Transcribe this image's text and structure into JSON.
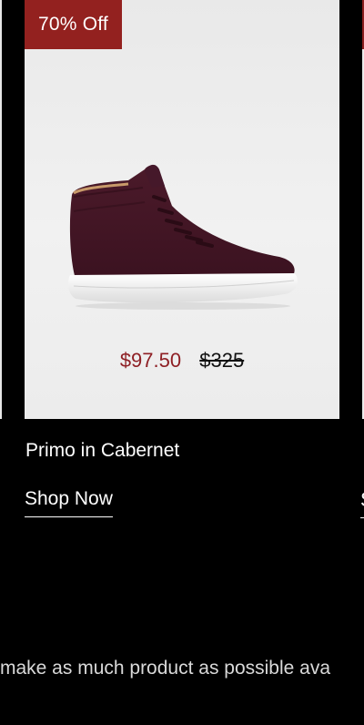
{
  "colors": {
    "background": "#000000",
    "badge": "#93211f",
    "sale_price": "#8e1f24",
    "text_light": "#ffffff"
  },
  "product": {
    "badge": "70% Off",
    "sale_price": "$97.50",
    "original_price": "$325",
    "name": "Primo in Cabernet",
    "cta": "Shop Now",
    "image_icon": "high-top-sneaker-image"
  },
  "next_product": {
    "cta_partial": "S"
  },
  "marquee": {
    "text": "make as much product as possible ava"
  }
}
